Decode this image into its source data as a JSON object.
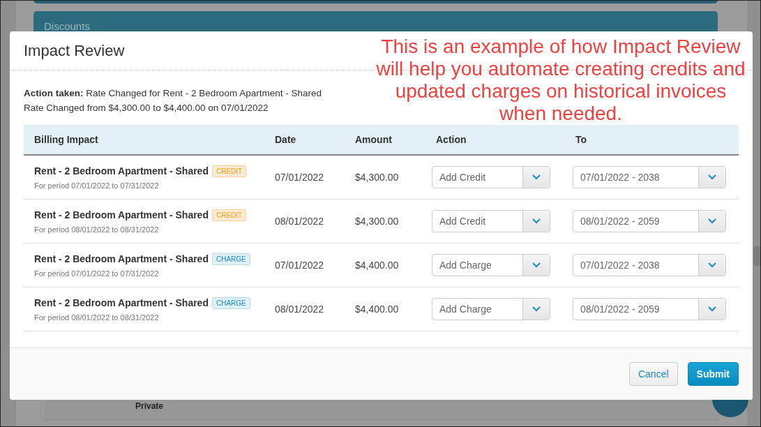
{
  "background": {
    "section_title": "Discounts",
    "field_value": "Private"
  },
  "modal": {
    "title": "Impact Review",
    "action_label": "Action taken:",
    "action_text": "Rate Changed for Rent - 2 Bedroom Apartment - Shared",
    "change_text": "Rate Changed from $4,300.00 to $4,400.00 on 07/01/2022",
    "columns": [
      "Billing Impact",
      "Date",
      "Amount",
      "Action",
      "To"
    ],
    "rows": [
      {
        "name": "Rent - 2 Bedroom Apartment - Shared",
        "tag": "CREDIT",
        "kind": "credit",
        "period": "For period 07/01/2022 to 07/31/2022",
        "date": "07/01/2022",
        "amount": "$4,300.00",
        "action": "Add Credit",
        "to": "07/01/2022 - 2038"
      },
      {
        "name": "Rent - 2 Bedroom Apartment - Shared",
        "tag": "CREDIT",
        "kind": "credit",
        "period": "For period 08/01/2022 to 08/31/2022",
        "date": "08/01/2022",
        "amount": "$4,300.00",
        "action": "Add Credit",
        "to": "08/01/2022 - 2059"
      },
      {
        "name": "Rent - 2 Bedroom Apartment - Shared",
        "tag": "CHARGE",
        "kind": "charge",
        "period": "For period 07/01/2022 to 07/31/2022",
        "date": "07/01/2022",
        "amount": "$4,400.00",
        "action": "Add Charge",
        "to": "07/01/2022 - 2038"
      },
      {
        "name": "Rent - 2 Bedroom Apartment - Shared",
        "tag": "CHARGE",
        "kind": "charge",
        "period": "For period 08/01/2022 to 08/31/2022",
        "date": "08/01/2022",
        "amount": "$4,400.00",
        "action": "Add Charge",
        "to": "08/01/2022 - 2059"
      }
    ],
    "buttons": [
      {
        "label": "Cancel",
        "kind": "secondary"
      },
      {
        "label": "Submit",
        "kind": "primary"
      }
    ]
  },
  "annotation": "This is an example of how Impact Review will help you automate creating credits and updated charges on historical invoices when needed."
}
